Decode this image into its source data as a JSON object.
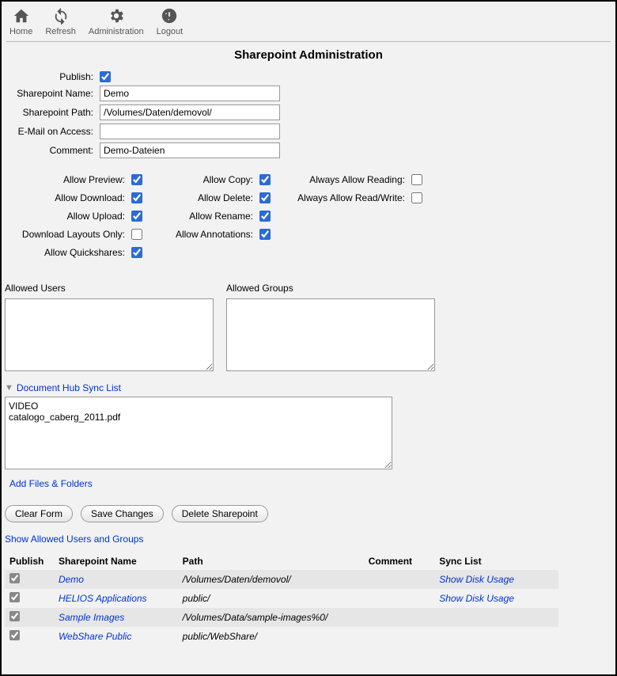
{
  "toolbar": [
    {
      "name": "home",
      "label": "Home"
    },
    {
      "name": "refresh",
      "label": "Refresh"
    },
    {
      "name": "administration",
      "label": "Administration"
    },
    {
      "name": "logout",
      "label": "Logout"
    }
  ],
  "page_title": "Sharepoint Administration",
  "form": {
    "publish_label": "Publish:",
    "publish_checked": true,
    "name_label": "Sharepoint Name:",
    "name_value": "Demo",
    "path_label": "Sharepoint Path:",
    "path_value": "/Volumes/Daten/demovol/",
    "email_label": "E-Mail on Access:",
    "email_value": "",
    "comment_label": "Comment:",
    "comment_value": "Demo-Dateien"
  },
  "perms": {
    "allow_preview": {
      "label": "Allow Preview:",
      "checked": true
    },
    "allow_download": {
      "label": "Allow Download:",
      "checked": true
    },
    "allow_upload": {
      "label": "Allow Upload:",
      "checked": true
    },
    "download_layouts_only": {
      "label": "Download Layouts Only:",
      "checked": false
    },
    "allow_quickshares": {
      "label": "Allow Quickshares:",
      "checked": true
    },
    "allow_copy": {
      "label": "Allow Copy:",
      "checked": true
    },
    "allow_delete": {
      "label": "Allow Delete:",
      "checked": true
    },
    "allow_rename": {
      "label": "Allow Rename:",
      "checked": true
    },
    "allow_annotations": {
      "label": "Allow Annotations:",
      "checked": true
    },
    "always_allow_reading": {
      "label": "Always Allow Reading:",
      "checked": false
    },
    "always_allow_readwrite": {
      "label": "Always Allow Read/Write:",
      "checked": false
    }
  },
  "allowed_users_label": "Allowed Users",
  "allowed_groups_label": "Allowed Groups",
  "allowed_users_value": "",
  "allowed_groups_value": "",
  "dhub": {
    "header": "Document Hub Sync List",
    "content": "VIDEO\ncatalogo_caberg_2011.pdf",
    "add_link": "Add Files & Folders"
  },
  "buttons": {
    "clear": "Clear Form",
    "save": "Save Changes",
    "delete": "Delete Sharepoint"
  },
  "show_allowed_link": "Show Allowed Users and Groups",
  "table": {
    "headers": {
      "publish": "Publish",
      "name": "Sharepoint Name",
      "path": "Path",
      "comment": "Comment",
      "sync": "Sync List"
    },
    "rows": [
      {
        "publish": true,
        "name": "Demo",
        "path": "/Volumes/Daten/demovol/",
        "comment": "",
        "sync": "Show Disk Usage"
      },
      {
        "publish": true,
        "name": "HELIOS Applications",
        "path": "public/",
        "comment": "",
        "sync": "Show Disk Usage"
      },
      {
        "publish": true,
        "name": "Sample Images",
        "path": "/Volumes/Data/sample-images%0/",
        "comment": "",
        "sync": ""
      },
      {
        "publish": true,
        "name": "WebShare Public",
        "path": "public/WebShare/",
        "comment": "",
        "sync": ""
      }
    ]
  }
}
